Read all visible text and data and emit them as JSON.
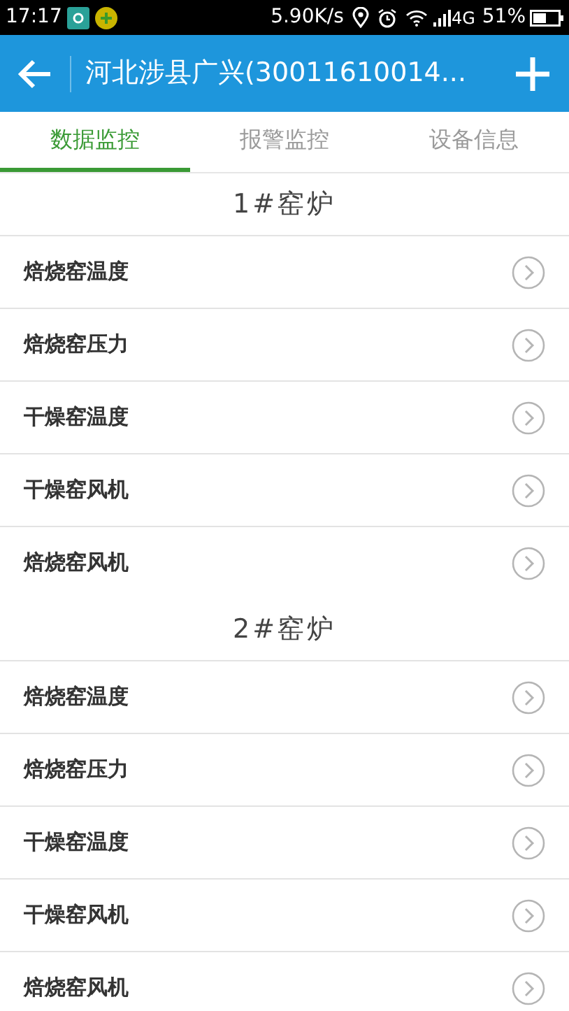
{
  "status_bar": {
    "time": "17:17",
    "speed": "5.90K/s",
    "network": "4G",
    "battery": "51%"
  },
  "header": {
    "title": "河北涉县广兴(30011610014..."
  },
  "tabs": [
    {
      "label": "数据监控",
      "selected": true
    },
    {
      "label": "报警监控",
      "selected": false
    },
    {
      "label": "设备信息",
      "selected": false
    }
  ],
  "sections": [
    {
      "title": "1#窑炉",
      "items": [
        "焙烧窑温度",
        "焙烧窑压力",
        "干燥窑温度",
        "干燥窑风机",
        "焙烧窑风机"
      ]
    },
    {
      "title": "2#窑炉",
      "items": [
        "焙烧窑温度",
        "焙烧窑压力",
        "干燥窑温度",
        "干燥窑风机",
        "焙烧窑风机"
      ]
    }
  ]
}
